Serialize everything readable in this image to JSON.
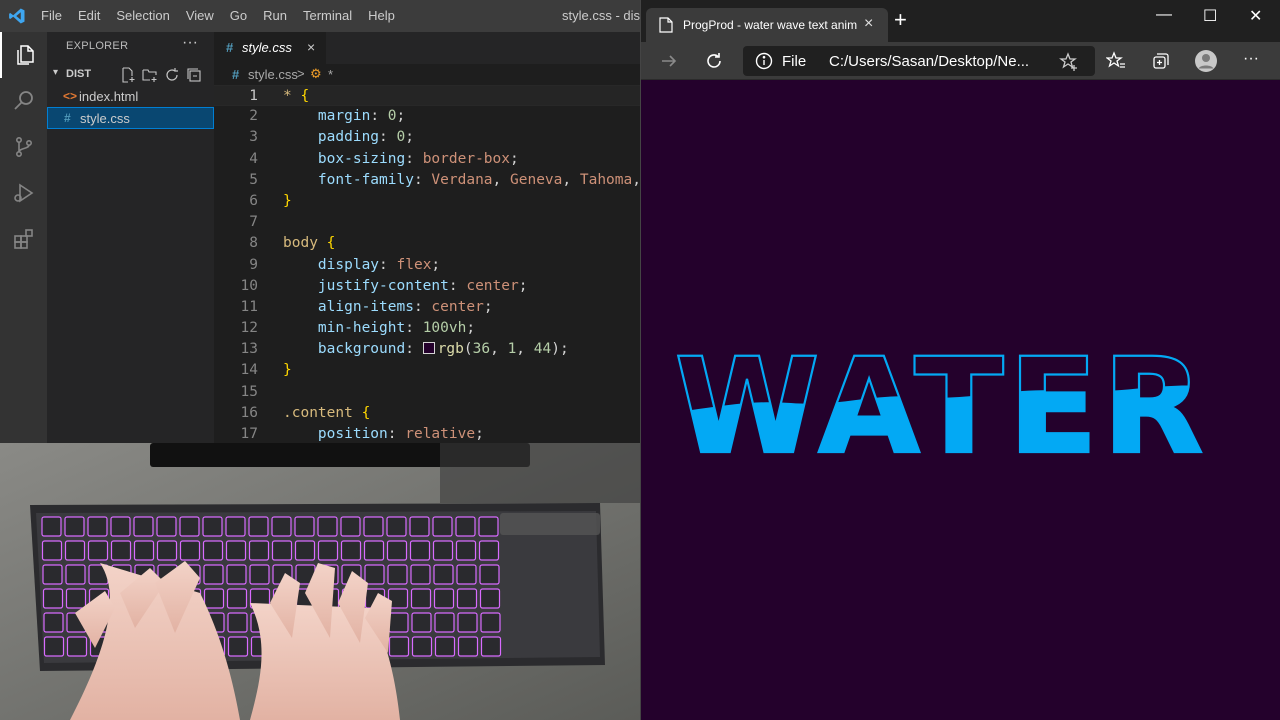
{
  "vscode": {
    "menu": [
      "File",
      "Edit",
      "Selection",
      "View",
      "Go",
      "Run",
      "Terminal",
      "Help"
    ],
    "window_title": "style.css - dis",
    "explorer": {
      "header": "EXPLORER",
      "folder": "DIST",
      "files": [
        {
          "name": "index.html",
          "icon": "<>",
          "selected": false
        },
        {
          "name": "style.css",
          "icon": "#",
          "selected": true
        }
      ]
    },
    "tab": {
      "label": "style.css",
      "close": "×"
    },
    "breadcrumb": {
      "file": "style.css",
      "separator": ">",
      "symbol": "*"
    },
    "code_lines": [
      {
        "n": "1",
        "tokens": [
          [
            "sel",
            "* "
          ],
          [
            "brace",
            "{"
          ]
        ]
      },
      {
        "n": "2",
        "tokens": [
          [
            "prop",
            "    margin"
          ],
          [
            "plain",
            ": "
          ],
          [
            "numv",
            "0"
          ],
          [
            "plain",
            ";"
          ]
        ]
      },
      {
        "n": "3",
        "tokens": [
          [
            "prop",
            "    padding"
          ],
          [
            "plain",
            ": "
          ],
          [
            "numv",
            "0"
          ],
          [
            "plain",
            ";"
          ]
        ]
      },
      {
        "n": "4",
        "tokens": [
          [
            "prop",
            "    box-sizing"
          ],
          [
            "plain",
            ": "
          ],
          [
            "val",
            "border-box"
          ],
          [
            "plain",
            ";"
          ]
        ]
      },
      {
        "n": "5",
        "tokens": [
          [
            "prop",
            "    font-family"
          ],
          [
            "plain",
            ": "
          ],
          [
            "val",
            "Verdana"
          ],
          [
            "plain",
            ", "
          ],
          [
            "val",
            "Geneva"
          ],
          [
            "plain",
            ", "
          ],
          [
            "val",
            "Tahoma"
          ],
          [
            "plain",
            ","
          ]
        ]
      },
      {
        "n": "6",
        "tokens": [
          [
            "brace",
            "}"
          ]
        ]
      },
      {
        "n": "7",
        "tokens": []
      },
      {
        "n": "8",
        "tokens": [
          [
            "sel",
            "body "
          ],
          [
            "brace",
            "{"
          ]
        ]
      },
      {
        "n": "9",
        "tokens": [
          [
            "prop",
            "    display"
          ],
          [
            "plain",
            ": "
          ],
          [
            "val",
            "flex"
          ],
          [
            "plain",
            ";"
          ]
        ]
      },
      {
        "n": "10",
        "tokens": [
          [
            "prop",
            "    justify-content"
          ],
          [
            "plain",
            ": "
          ],
          [
            "val",
            "center"
          ],
          [
            "plain",
            ";"
          ]
        ]
      },
      {
        "n": "11",
        "tokens": [
          [
            "prop",
            "    align-items"
          ],
          [
            "plain",
            ": "
          ],
          [
            "val",
            "center"
          ],
          [
            "plain",
            ";"
          ]
        ]
      },
      {
        "n": "12",
        "tokens": [
          [
            "prop",
            "    min-height"
          ],
          [
            "plain",
            ": "
          ],
          [
            "numv",
            "100vh"
          ],
          [
            "plain",
            ";"
          ]
        ]
      },
      {
        "n": "13",
        "tokens": [
          [
            "prop",
            "    background"
          ],
          [
            "plain",
            ": "
          ],
          [
            "swatch",
            ""
          ],
          [
            "fn",
            "rgb"
          ],
          [
            "plain",
            "("
          ],
          [
            "numv",
            "36"
          ],
          [
            "plain",
            ", "
          ],
          [
            "numv",
            "1"
          ],
          [
            "plain",
            ", "
          ],
          [
            "numv",
            "44"
          ],
          [
            "plain",
            ");"
          ]
        ]
      },
      {
        "n": "14",
        "tokens": [
          [
            "brace",
            "}"
          ]
        ]
      },
      {
        "n": "15",
        "tokens": []
      },
      {
        "n": "16",
        "tokens": [
          [
            "sel",
            ".content "
          ],
          [
            "brace",
            "{"
          ]
        ]
      },
      {
        "n": "17",
        "tokens": [
          [
            "prop",
            "    position"
          ],
          [
            "plain",
            ": "
          ],
          [
            "val",
            "relative"
          ],
          [
            "plain",
            ";"
          ]
        ]
      }
    ]
  },
  "browser": {
    "tab_title": "ProgProd - water wave text anim",
    "tab_close": "×",
    "new_tab": "+",
    "window_controls": [
      "—",
      "☐",
      "✕"
    ],
    "address_scheme": "File",
    "address_url": "C:/Users/Sasan/Desktop/Ne...",
    "page_text": "WATER",
    "colors": {
      "background": "#24012c",
      "water": "#03a9f4"
    }
  },
  "webcam": {
    "description_icon": "keyboard-with-hands-icon"
  }
}
